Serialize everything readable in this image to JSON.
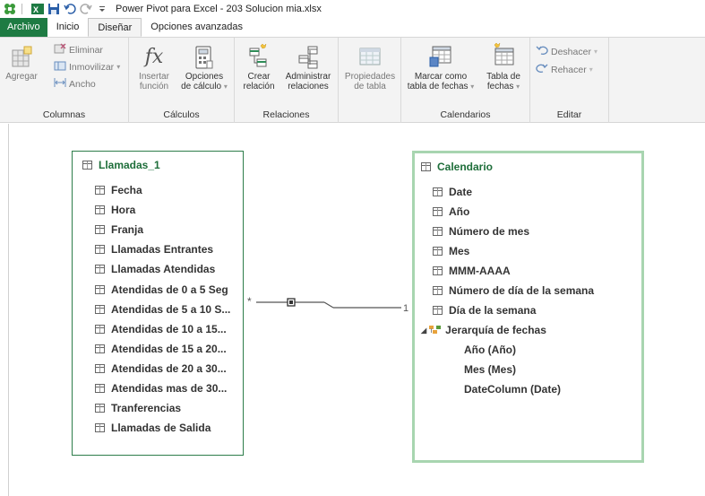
{
  "window": {
    "title": "Power Pivot para Excel - 203 Solucion mia.xlsx"
  },
  "tabs": [
    {
      "label": "Archivo"
    },
    {
      "label": "Inicio"
    },
    {
      "label": "Diseñar"
    },
    {
      "label": "Opciones avanzadas"
    }
  ],
  "ribbon": {
    "columnas": {
      "label": "Columnas",
      "agregar": "Agregar",
      "eliminar": "Eliminar",
      "inmovilizar": "Inmovilizar",
      "ancho": "Ancho"
    },
    "calculos": {
      "label": "Cálculos",
      "insertar_line1": "Insertar",
      "insertar_line2": "función",
      "opciones_line1": "Opciones",
      "opciones_line2": "de cálculo"
    },
    "relaciones": {
      "label": "Relaciones",
      "crear_line1": "Crear",
      "crear_line2": "relación",
      "admin_line1": "Administrar",
      "admin_line2": "relaciones"
    },
    "propiedades": {
      "line1": "Propiedades",
      "line2": "de tabla"
    },
    "calendarios": {
      "label": "Calendarios",
      "marcar_line1": "Marcar como",
      "marcar_line2": "tabla de fechas",
      "tabla_line1": "Tabla de",
      "tabla_line2": "fechas"
    },
    "editar": {
      "label": "Editar",
      "deshacer": "Deshacer",
      "rehacer": "Rehacer"
    }
  },
  "diagram": {
    "left_table": {
      "name": "Llamadas_1",
      "fields": [
        "Fecha",
        "Hora",
        "Franja",
        "Llamadas Entrantes",
        "Llamadas Atendidas",
        "Atendidas de 0 a 5 Seg",
        "Atendidas de 5 a 10 S...",
        "Atendidas de 10 a 15...",
        "Atendidas de 15 a 20...",
        "Atendidas de 20 a 30...",
        "Atendidas mas de 30...",
        "Tranferencias",
        "Llamadas de Salida"
      ]
    },
    "right_table": {
      "name": "Calendario",
      "fields": [
        "Date",
        "Año",
        "Número de mes",
        "Mes",
        "MMM-AAAA",
        "Número de día de la semana",
        "Día de la semana"
      ],
      "hierarchy": {
        "name": "Jerarquía de fechas",
        "levels": [
          "Año (Año)",
          "Mes (Mes)",
          "DateColumn (Date)"
        ]
      }
    },
    "relationship": {
      "many_label": "*",
      "one_label": "1"
    }
  },
  "colors": {
    "brand_green": "#1e7b43",
    "table_title": "#1e6e3a",
    "selected_border": "#a8d5b0",
    "table_border": "#2d7d4a"
  }
}
